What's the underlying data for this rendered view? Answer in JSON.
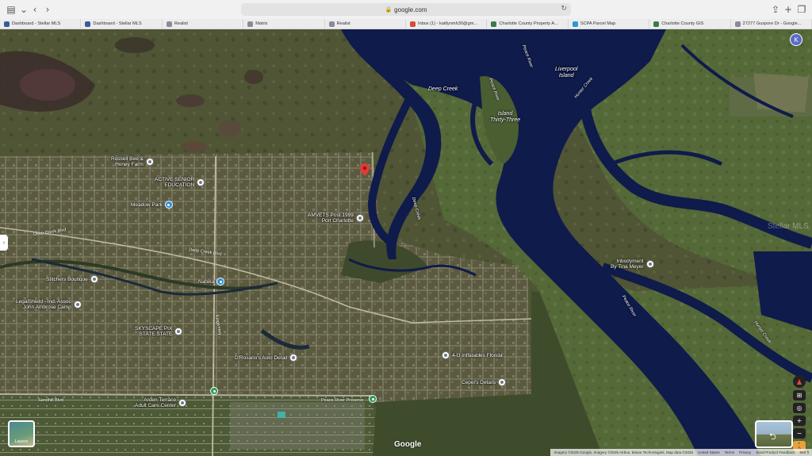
{
  "browser": {
    "url": "google.com",
    "tabs": [
      {
        "label": "Dashboard - Stellar MLS",
        "color": "#3a5a9a"
      },
      {
        "label": "Dashboard - Stellar MLS",
        "color": "#3a5a9a"
      },
      {
        "label": "Realist",
        "color": "#8a8a9a"
      },
      {
        "label": "Matrix",
        "color": "#8a8a9a"
      },
      {
        "label": "Realist",
        "color": "#8a8a9a"
      },
      {
        "label": "Inbox (1) - kaitlynmh30@gm...",
        "color": "#d94a3a"
      },
      {
        "label": "Charlotte County Property A...",
        "color": "#3c7a4a"
      },
      {
        "label": "SCPA Parcel Map",
        "color": "#2a9ad0"
      },
      {
        "label": "Charlotte County GIS",
        "color": "#3c7a4a"
      },
      {
        "label": "27277 Guspore Dr - Google...",
        "color": "#8a8a9a"
      }
    ]
  },
  "map": {
    "account_initial": "K",
    "layers_label": "Layers",
    "google_logo": "Google",
    "watermark": "Stellar MLS",
    "water_labels": {
      "deep_creek": "Deep Creek",
      "island": "Island\nThirty-Three",
      "liverpool": "Liverpool\nIsland",
      "peace_river_top": "Peace River",
      "hunter_creek": "Hunter Creek",
      "peace_river_mid": "Peace River",
      "peace_river_low": "Peace River",
      "deep_creek_2": "Deep Creek",
      "hunter_creek_2": "Hunter Creek"
    },
    "road_labels": {
      "deep_creek_blvd": "Deep Creek Blvd",
      "deep_creek_blvd2": "Deep Creek Blvd",
      "sandhill": "Sandhill Blvd",
      "kings": "Kings Hwy",
      "peace_river_preserve": "Peace River Preserve"
    },
    "places": {
      "russell_bee": "Russell Bee &\nHoney Farm",
      "active_senior": "ACTIVE SENIOR\nEDUCATION",
      "meadow_park": "Meadow Park",
      "amvets": "AMVETS Post 1999\nPort Charlotte",
      "stitchers": "Stitchers Boutique",
      "legalshield": "LegalShield - Ind. Assoc\nJohn Ambrose Camp",
      "nabika": "Nabika",
      "skyscape": "SKYSCAPE PIX\nSTATE STATE",
      "dorsanos": "D'Rosario's Auto Detail",
      "inflatables": "4-U Inflatables Florida",
      "cepei": "Cepei's Details",
      "arden": "Arden Terrace\nAdult Care Center",
      "inbodyment": "Inbodyment\nBy Tina Meyer"
    },
    "attribution": {
      "imagery": "Imagery ©2025 Google, Imagery ©2025 Airbus, Maxar Technologies, Map data ©2025",
      "country": "United States",
      "terms": "Terms",
      "privacy": "Privacy",
      "feedback": "Send Product Feedback",
      "scale": "500 ft"
    },
    "colors": {
      "water": "#0f1b4a",
      "marsh": "#4a5a32",
      "land": "#5a5a3c",
      "pin": "#e53935"
    }
  }
}
